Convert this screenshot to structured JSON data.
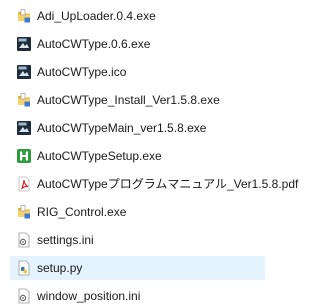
{
  "files": [
    {
      "name": "Adi_UpLoader.0.4.exe",
      "icon": "folder-app-icon"
    },
    {
      "name": "AutoCWType.0.6.exe",
      "icon": "acw-app-icon"
    },
    {
      "name": "AutoCWType.ico",
      "icon": "acw-app-icon"
    },
    {
      "name": "AutoCWType_Install_Ver1.5.8.exe",
      "icon": "folder-app-icon"
    },
    {
      "name": "AutoCWTypeMain_ver1.5.8.exe",
      "icon": "acw-app-icon"
    },
    {
      "name": "AutoCWTypeSetup.exe",
      "icon": "green-h-setup-icon"
    },
    {
      "name": "AutoCWTypeプログラムマニュアル_Ver1.5.8.pdf",
      "icon": "pdf-icon"
    },
    {
      "name": "RIG_Control.exe",
      "icon": "folder-app-icon"
    },
    {
      "name": "settings.ini",
      "icon": "ini-gear-icon"
    },
    {
      "name": "setup.py",
      "icon": "python-file-icon"
    },
    {
      "name": "window_position.ini",
      "icon": "ini-gear-icon"
    }
  ],
  "selected_file": "setup.py",
  "colors": {
    "selection_background": "#e5f3ff",
    "folder_yellow": "#f2c84b",
    "acw_icon_dark": "#1d2b3a",
    "setup_green": "#2e9b3f",
    "pdf_red": "#d2232a"
  }
}
